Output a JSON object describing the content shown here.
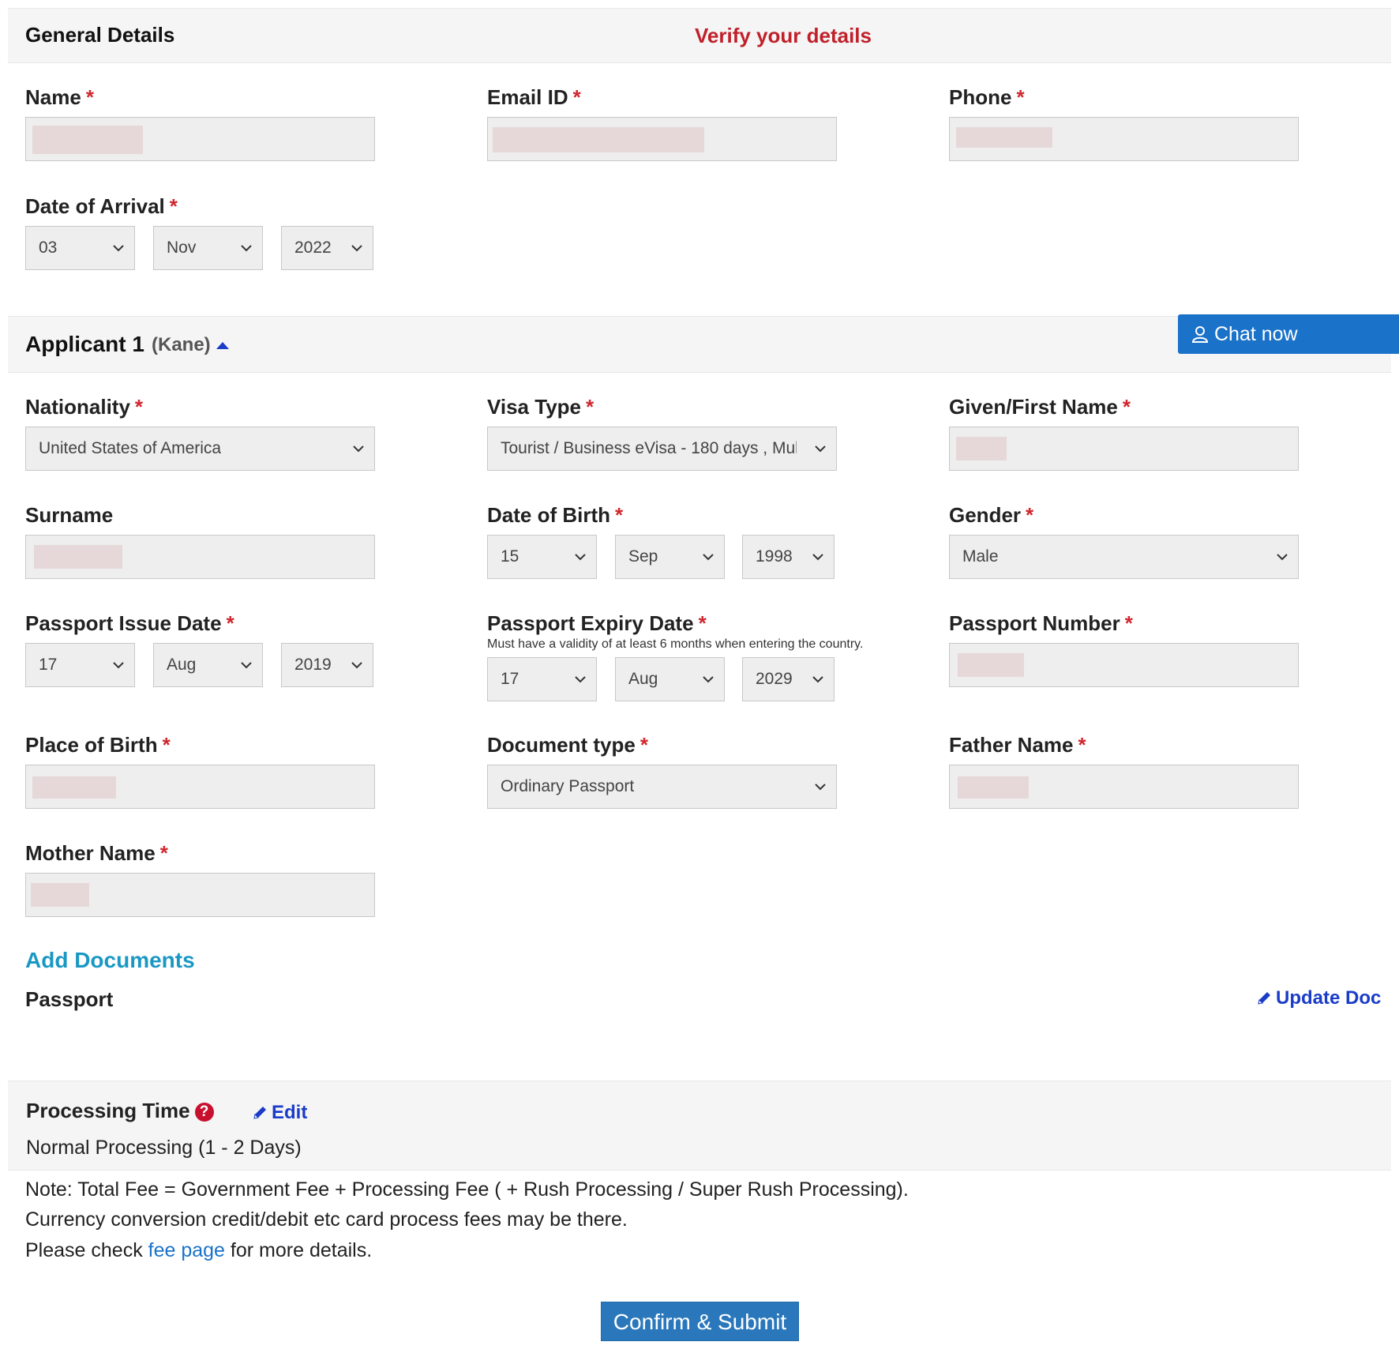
{
  "general": {
    "title": "General Details",
    "verify_text": "Verify your details",
    "name_label": "Name",
    "email_label": "Email ID",
    "phone_label": "Phone",
    "arrival_label": "Date of Arrival",
    "arrival_day": "03",
    "arrival_month": "Nov",
    "arrival_year": "2022",
    "required_mark": "*"
  },
  "chat": {
    "label": "Chat now"
  },
  "applicant": {
    "title": "Applicant 1",
    "name_tag": "(Kane)",
    "nationality_label": "Nationality",
    "nationality_value": "United States of America",
    "visa_type_label": "Visa Type",
    "visa_type_value": "Tourist / Business eVisa - 180 days , Mul",
    "given_name_label": "Given/First Name",
    "surname_label": "Surname",
    "dob_label": "Date of Birth",
    "dob_day": "15",
    "dob_month": "Sep",
    "dob_year": "1998",
    "gender_label": "Gender",
    "gender_value": "Male",
    "passport_issue_label": "Passport Issue Date",
    "issue_day": "17",
    "issue_month": "Aug",
    "issue_year": "2019",
    "passport_expiry_label": "Passport Expiry Date",
    "expiry_hint": "Must have a validity of at least 6 months when entering the country.",
    "expiry_day": "17",
    "expiry_month": "Aug",
    "expiry_year": "2029",
    "passport_number_label": "Passport Number",
    "place_of_birth_label": "Place of Birth",
    "document_type_label": "Document type",
    "document_type_value": "Ordinary Passport",
    "father_name_label": "Father Name",
    "mother_name_label": "Mother Name"
  },
  "documents": {
    "add_label": "Add Documents",
    "passport_label": "Passport",
    "update_label": "Update Doc"
  },
  "processing": {
    "title": "Processing Time",
    "help_glyph": "?",
    "edit_label": "Edit",
    "value": "Normal Processing (1 - 2 Days)"
  },
  "notes": {
    "line1": "Note: Total Fee = Government Fee + Processing Fee ( + Rush Processing / Super Rush Processing).",
    "line2": "Currency conversion credit/debit etc card process fees may be there.",
    "line3_before": "Please check ",
    "line3_link": "fee page",
    "line3_after": " for more details."
  },
  "submit": {
    "label": "Confirm & Submit"
  },
  "colors": {
    "accent_blue": "#1a72c9",
    "required_red": "#d0272f",
    "verify_red": "#c0202a",
    "add_docs_teal": "#1a98c4"
  }
}
